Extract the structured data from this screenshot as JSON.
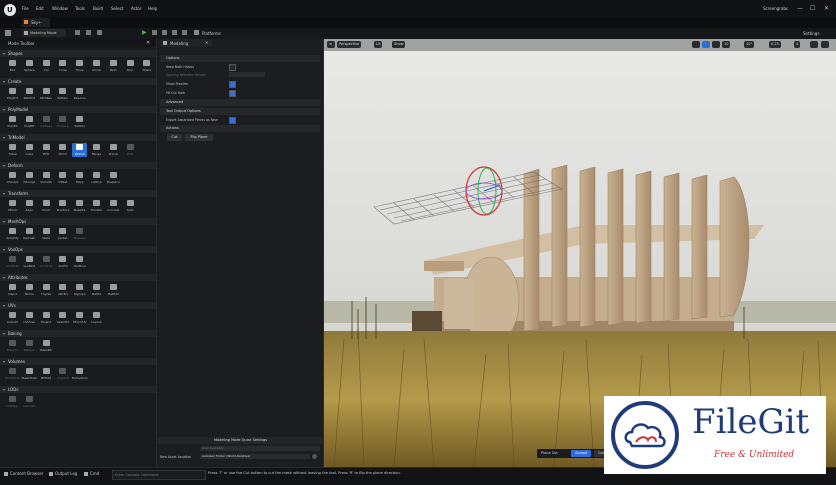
{
  "app": {
    "menu": [
      "File",
      "Edit",
      "Window",
      "Tools",
      "Build",
      "Select",
      "Actor",
      "Help"
    ],
    "project_name": "Screengrabs",
    "tab_label": "Sky+"
  },
  "toolbar": {
    "mode_label": "Modeling Mode",
    "platforms_label": "Platforms",
    "settings_label": "Settings"
  },
  "left_panel": {
    "title": "Mode Toolbar",
    "sections": [
      {
        "name": "Shapes",
        "tools": [
          {
            "label": "Box"
          },
          {
            "label": "Sphere"
          },
          {
            "label": "Cyl"
          },
          {
            "label": "Cone"
          },
          {
            "label": "Torus"
          },
          {
            "label": "Arrow"
          },
          {
            "label": "Rect"
          },
          {
            "label": "Disc"
          },
          {
            "label": "Stairs"
          }
        ]
      },
      {
        "name": "Create",
        "tools": [
          {
            "label": "PolyExt"
          },
          {
            "label": "PathExt"
          },
          {
            "label": "PathRev"
          },
          {
            "label": "Pattern"
          },
          {
            "label": "Revolve"
          }
        ]
      },
      {
        "name": "PolyModel",
        "tools": [
          {
            "label": "PolyEd"
          },
          {
            "label": "PolyEff"
          },
          {
            "label": "InsEdge"
          },
          {
            "label": "PolyGrp"
          },
          {
            "label": "SubDiv"
          }
        ]
      },
      {
        "name": "TriModel",
        "tools": [
          {
            "label": "TriSel"
          },
          {
            "label": "Cube"
          },
          {
            "label": "HFill"
          },
          {
            "label": "Mirror"
          },
          {
            "label": "PlnCut"
          },
          {
            "label": "Merge"
          },
          {
            "label": "PrjCut"
          },
          {
            "label": "Edit"
          }
        ]
      },
      {
        "name": "Deform",
        "tools": [
          {
            "label": "VSculpt"
          },
          {
            "label": "DSculpt"
          },
          {
            "label": "Smooth"
          },
          {
            "label": "Offset"
          },
          {
            "label": "Warp"
          },
          {
            "label": "Lattice"
          },
          {
            "label": "Displace"
          }
        ]
      },
      {
        "name": "Transform",
        "tools": [
          {
            "label": "XForm"
          },
          {
            "label": "Align"
          },
          {
            "label": "Pivot"
          },
          {
            "label": "PivotAct"
          },
          {
            "label": "BakeRS"
          },
          {
            "label": "Transfer"
          },
          {
            "label": "Convert"
          },
          {
            "label": "Split"
          }
        ]
      },
      {
        "name": "MeshOps",
        "tools": [
          {
            "label": "Simplify"
          },
          {
            "label": "Remesh"
          },
          {
            "label": "Weld"
          },
          {
            "label": "Jacket"
          },
          {
            "label": "Boolean"
          }
        ]
      },
      {
        "name": "VoxOps",
        "tools": [
          {
            "label": "VoxWrap"
          },
          {
            "label": "VoxBlnd"
          },
          {
            "label": "VoxMrph"
          },
          {
            "label": "VoxFill"
          },
          {
            "label": "VoxBool"
          }
        ]
      },
      {
        "name": "Attributes",
        "tools": [
          {
            "label": "Inspct"
          },
          {
            "label": "Nrmls"
          },
          {
            "label": "Tngnts"
          },
          {
            "label": "AttrEd"
          },
          {
            "label": "PlyGrps"
          },
          {
            "label": "MatEd"
          },
          {
            "label": "MatEd2"
          }
        ]
      },
      {
        "name": "UVs",
        "tools": [
          {
            "label": "AutoUV"
          },
          {
            "label": "UVUnwr"
          },
          {
            "label": "Project"
          },
          {
            "label": "SeamEd"
          },
          {
            "label": "XFormUV"
          },
          {
            "label": "Layout"
          }
        ]
      },
      {
        "name": "Baking",
        "tools": [
          {
            "label": "BakeTx"
          },
          {
            "label": "BakeAll"
          },
          {
            "label": "BakeRS"
          }
        ]
      },
      {
        "name": "Volumes",
        "tools": [
          {
            "label": "VolToMesh"
          },
          {
            "label": "MeshToVol"
          },
          {
            "label": "BVEdit"
          },
          {
            "label": "PhysCol"
          },
          {
            "label": "ExtractCol"
          }
        ]
      },
      {
        "name": "LODs",
        "tools": [
          {
            "label": "LODMgr"
          },
          {
            "label": "GenLOD"
          }
        ]
      }
    ]
  },
  "details": {
    "tab_label": "Modeling",
    "options_header": "Options",
    "rows": [
      {
        "label": "Keep Both Halves",
        "checked": false
      },
      {
        "label": "Spacing Between Halves",
        "checked": false
      },
      {
        "label": "Show Preview",
        "checked": true
      },
      {
        "label": "Fill Cut Hole",
        "checked": true
      }
    ],
    "advanced_header": "Advanced",
    "tool_output_header": "Tool Output Options",
    "export_label": "Export Separated Pieces as New",
    "export_checked": true,
    "actions_header": "Actions",
    "cut_label": "Cut",
    "flip_label": "Flip Plane",
    "quick_settings_header": "Modeling Mode Quick Settings",
    "new_asset_label": "New Asset Location",
    "new_asset_value": "AutoGen Folder (World-Relative)",
    "row_placeholder_value": "User Available"
  },
  "viewport": {
    "perspective_label": "Perspective",
    "lit_label": "Lit",
    "show_label": "Show",
    "scale_numbers": [
      "10",
      "10°",
      "0.25",
      "4"
    ],
    "plane_cut_label": "Plane Cut",
    "accept_label": "Accept",
    "cancel_label": "Cancel"
  },
  "statusbar": {
    "content_browser": "Content Browser",
    "output_log": "Output Log",
    "cmd_label": "Cmd",
    "console_placeholder": "Enter Console Command",
    "hint": "Press 'T' or use the Cut button to cut the mesh without leaving the tool. Press 'R' to flip the plane direction."
  },
  "watermark": {
    "title": "FileGit",
    "subtitle": "Free & Unlimited"
  },
  "colors": {
    "accent": "#2b6fd6",
    "panel": "#1a1b1e",
    "accept": "#2f6ae0"
  }
}
